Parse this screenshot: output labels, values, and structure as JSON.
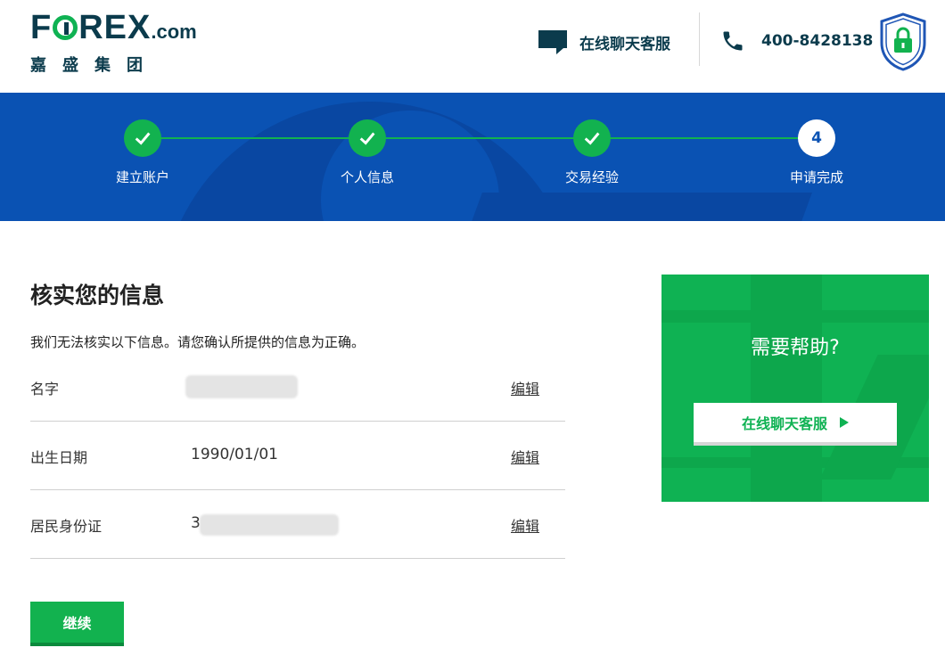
{
  "header": {
    "logo_main": "FOREX",
    "logo_domain": ".com",
    "logo_sub": "嘉盛集团",
    "chat_label": "在线聊天客服",
    "phone": "400-8428138",
    "icons": {
      "chat": "chat-bubble-icon",
      "phone": "phone-icon",
      "lock": "lock-shield-icon"
    }
  },
  "progress": {
    "steps": [
      {
        "label": "建立账户",
        "status": "done"
      },
      {
        "label": "个人信息",
        "status": "done"
      },
      {
        "label": "交易经验",
        "status": "done"
      },
      {
        "label": "申请完成",
        "status": "current",
        "number": "4"
      }
    ]
  },
  "main": {
    "title": "核实您的信息",
    "intro": "我们无法核实以下信息。请您确认所提供的信息为正确。",
    "rows": [
      {
        "label": "名字",
        "value": "",
        "edit": "编辑"
      },
      {
        "label": "出生日期",
        "value": "1990/01/01",
        "edit": "编辑"
      },
      {
        "label": "居民身份证",
        "value": "3",
        "edit": "编辑"
      }
    ],
    "continue_label": "继续"
  },
  "help": {
    "title": "需要帮助?",
    "button_label": "在线聊天客服"
  },
  "colors": {
    "brand_navy": "#0b3b4c",
    "brand_green": "#12b24f",
    "banner_blue": "#0a52b3"
  }
}
